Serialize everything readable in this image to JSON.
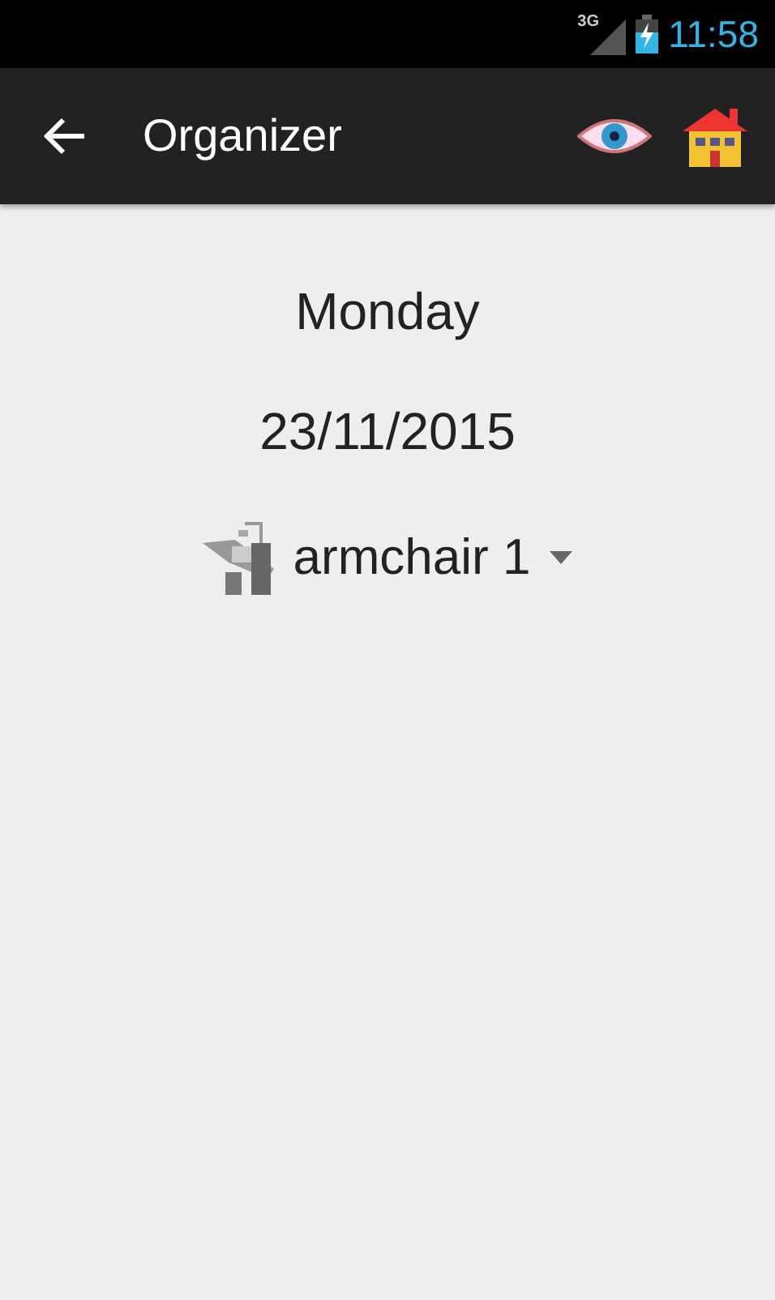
{
  "status_bar": {
    "network": "3G",
    "time": "11:58"
  },
  "app_bar": {
    "title": "Organizer"
  },
  "day": "Monday",
  "date": "23/11/2015",
  "chair_selector": {
    "value": "armchair 1"
  }
}
